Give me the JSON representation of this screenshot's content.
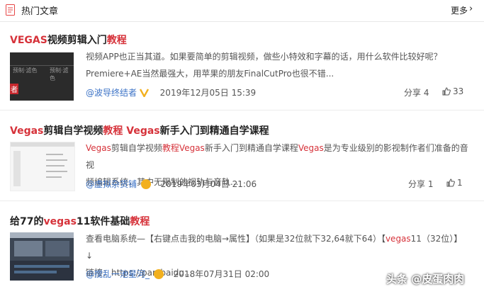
{
  "header": {
    "title": "热门文章",
    "more": "更多",
    "chevron": "›"
  },
  "articles": [
    {
      "title_parts": [
        "VEGAS",
        "视频剪辑入门",
        "教程"
      ],
      "snippet_line1": "视频APP也正当其道。如果要简单的剪辑视频，做些小特效和字幕的话，用什么软件比较好呢？",
      "snippet_line2": "Premiere+AE当然最强大，用苹果的朋友FinalCutPro也很不错...",
      "author": "@波导终结者",
      "date": "2019年12月05日 15:39",
      "share": "分享 4",
      "likes": "33",
      "thumb_text1": "预制·滤色",
      "thumb_text2": "预制·滤色",
      "thumb_badge": "者"
    },
    {
      "title_parts": [
        "Vegas",
        "剪辑自学视频",
        "教程",
        " ",
        "Vegas",
        "新手入门到精通自学课程"
      ],
      "snippet_parts": [
        "Vegas",
        "剪辑自学视频",
        "教程",
        "Vegas",
        "新手入门到精通自学课程",
        "Vegas",
        "是为专业级别的影视制作者们准备的音视"
      ],
      "snippet_line2": "频编辑系统，其中无限制的视轨与音轨...",
      "author": "@虚拟杂货铺",
      "date": "2019年03月04日 21:06",
      "share": "分享 1",
      "likes": "1"
    },
    {
      "title_parts": [
        "给77的",
        "vegas",
        "11软件基础",
        "教程"
      ],
      "snippet_parts": [
        "查看电脑系统—【右键点击我的电脑→属性】（如果是32位就下32,64就下64）【",
        "vegas",
        "11（32位）】↓"
      ],
      "snippet_line2": "链接：https://pan.baidu...",
      "author": "@搅乱一池星河_",
      "date": "2018年07月31日 02:00"
    }
  ],
  "watermark": "头条 @皮蛋肉肉",
  "colors": {
    "highlight": "#d6323a",
    "author": "#3b72c6",
    "gold_badge": "#f2b01e"
  }
}
